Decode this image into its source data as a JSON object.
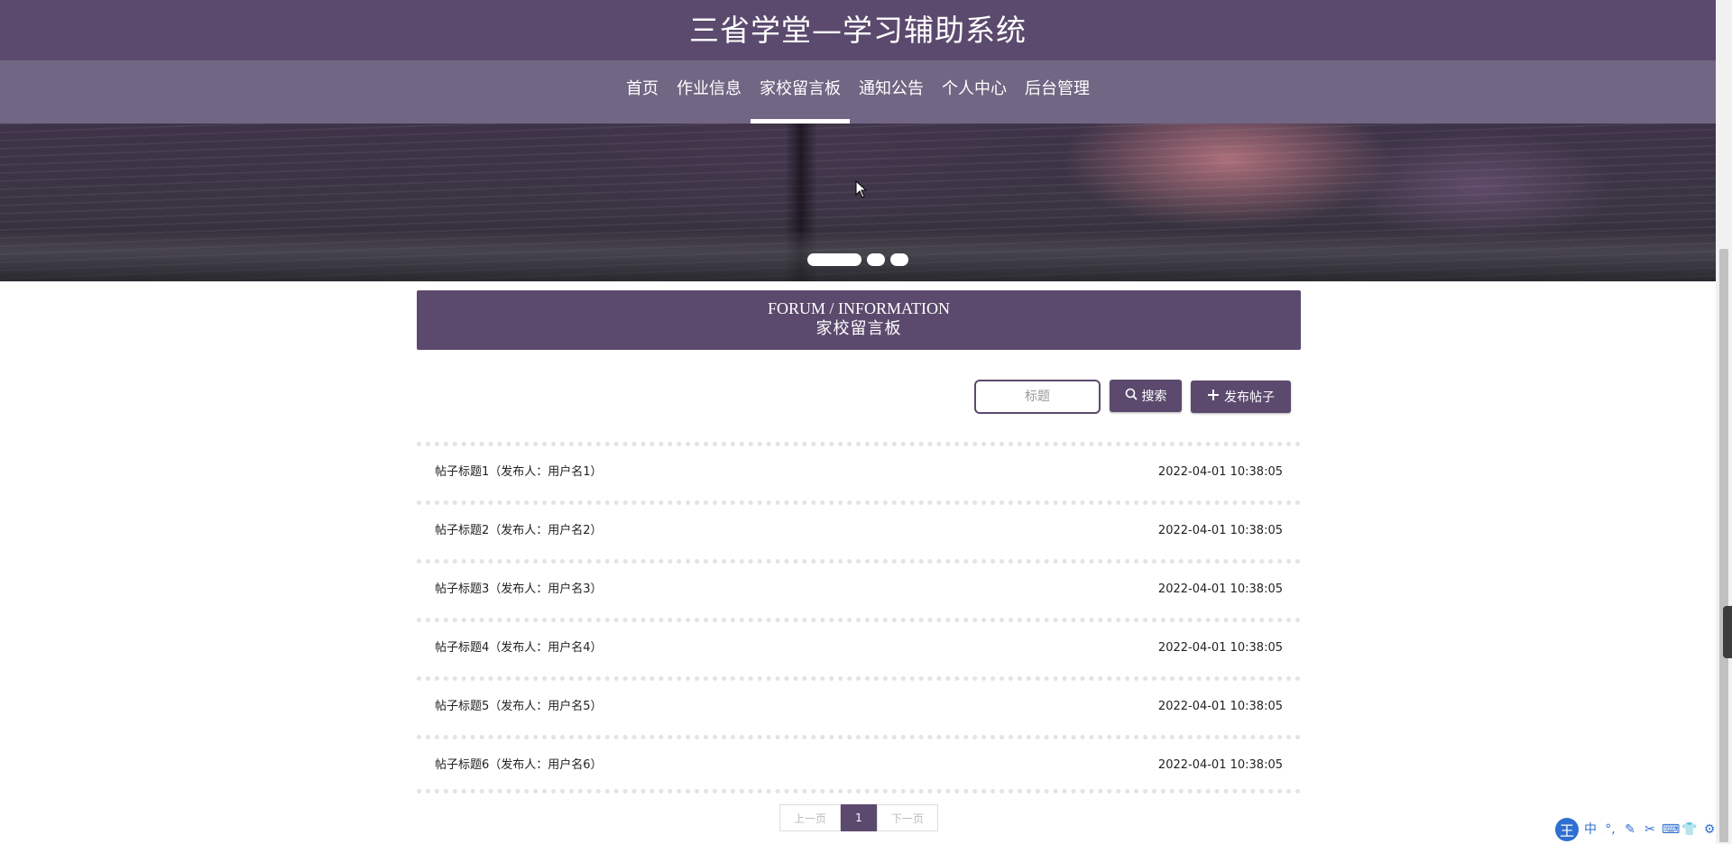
{
  "header": {
    "site_title": "三省学堂—学习辅助系统"
  },
  "nav": {
    "items": [
      {
        "label": "首页",
        "active": false
      },
      {
        "label": "作业信息",
        "active": false
      },
      {
        "label": "家校留言板",
        "active": true
      },
      {
        "label": "通知公告",
        "active": false
      },
      {
        "label": "个人中心",
        "active": false
      },
      {
        "label": "后台管理",
        "active": false
      }
    ]
  },
  "banner": {
    "slides": 3,
    "active_slide": 1
  },
  "section": {
    "title_en": "FORUM / INFORMATION",
    "title_cn": "家校留言板"
  },
  "search": {
    "placeholder": "标题",
    "value": "",
    "search_label": "搜索",
    "post_label": "发布帖子"
  },
  "posts": [
    {
      "title": "帖子标题1（发布人：用户名1）",
      "time": "2022-04-01 10:38:05"
    },
    {
      "title": "帖子标题2（发布人：用户名2）",
      "time": "2022-04-01 10:38:05"
    },
    {
      "title": "帖子标题3（发布人：用户名3）",
      "time": "2022-04-01 10:38:05"
    },
    {
      "title": "帖子标题4（发布人：用户名4）",
      "time": "2022-04-01 10:38:05"
    },
    {
      "title": "帖子标题5（发布人：用户名5）",
      "time": "2022-04-01 10:38:05"
    },
    {
      "title": "帖子标题6（发布人：用户名6）",
      "time": "2022-04-01 10:38:05"
    }
  ],
  "pagination": {
    "prev_label": "上一页",
    "current_page": "1",
    "next_label": "下一页"
  },
  "ime": {
    "logo": "王",
    "mode": "中"
  },
  "colors": {
    "brand": "#5b4a6e",
    "nav_bg": "#716683"
  }
}
